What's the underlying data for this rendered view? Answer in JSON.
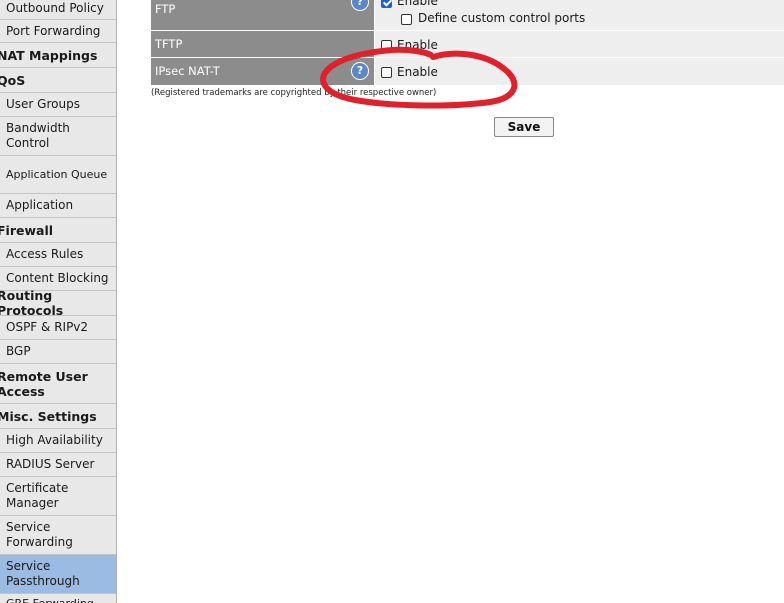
{
  "sidebar": {
    "items": [
      {
        "label": "Outbound Policy",
        "kind": "item"
      },
      {
        "label": "Port Forwarding",
        "kind": "item"
      },
      {
        "label": "NAT Mappings",
        "kind": "group"
      },
      {
        "label": "QoS",
        "kind": "group"
      },
      {
        "label": "User Groups",
        "kind": "item"
      },
      {
        "label": "Bandwidth Control",
        "kind": "item"
      },
      {
        "label": "Application Queue",
        "kind": "item"
      },
      {
        "label": "Application",
        "kind": "item"
      },
      {
        "label": "Firewall",
        "kind": "group"
      },
      {
        "label": "Access Rules",
        "kind": "item"
      },
      {
        "label": "Content Blocking",
        "kind": "item"
      },
      {
        "label": "Routing Protocols",
        "kind": "group"
      },
      {
        "label": "OSPF & RIPv2",
        "kind": "item"
      },
      {
        "label": "BGP",
        "kind": "item"
      },
      {
        "label": "Remote User Access",
        "kind": "group"
      },
      {
        "label": "Misc. Settings",
        "kind": "group"
      },
      {
        "label": "High Availability",
        "kind": "item"
      },
      {
        "label": "RADIUS Server",
        "kind": "item"
      },
      {
        "label": "Certificate Manager",
        "kind": "item"
      },
      {
        "label": "Service Forwarding",
        "kind": "item"
      },
      {
        "label": "Service Passthrough",
        "kind": "item",
        "active": true
      },
      {
        "label": "GRE Forwarding",
        "kind": "item"
      }
    ]
  },
  "passthrough": {
    "ftp": {
      "label": "FTP",
      "enable_label": "Enable",
      "enable_checked": true,
      "custom_ports_label": "Define custom control ports",
      "custom_ports_checked": false
    },
    "tftp": {
      "label": "TFTP",
      "enable_label": "Enable",
      "enable_checked": false
    },
    "ipsec": {
      "label": "IPsec NAT-T",
      "enable_label": "Enable",
      "enable_checked": false
    },
    "help_glyph": "?"
  },
  "footnote": "(Registered trademarks are copyrighted by their respective owner)",
  "save_label": "Save",
  "colors": {
    "label_bg": "#8c8c8c",
    "value_bg": "#eeeeee",
    "sidebar_bg": "#e8e8e8",
    "active_bg": "#9bbbe2",
    "help_icon": "#5b87c9",
    "annotation": "#e0202a"
  },
  "icons": {
    "help": "question-circle-icon",
    "checkbox_checked": "checkbox-checked-icon",
    "checkbox_unchecked": "checkbox-unchecked-icon"
  }
}
